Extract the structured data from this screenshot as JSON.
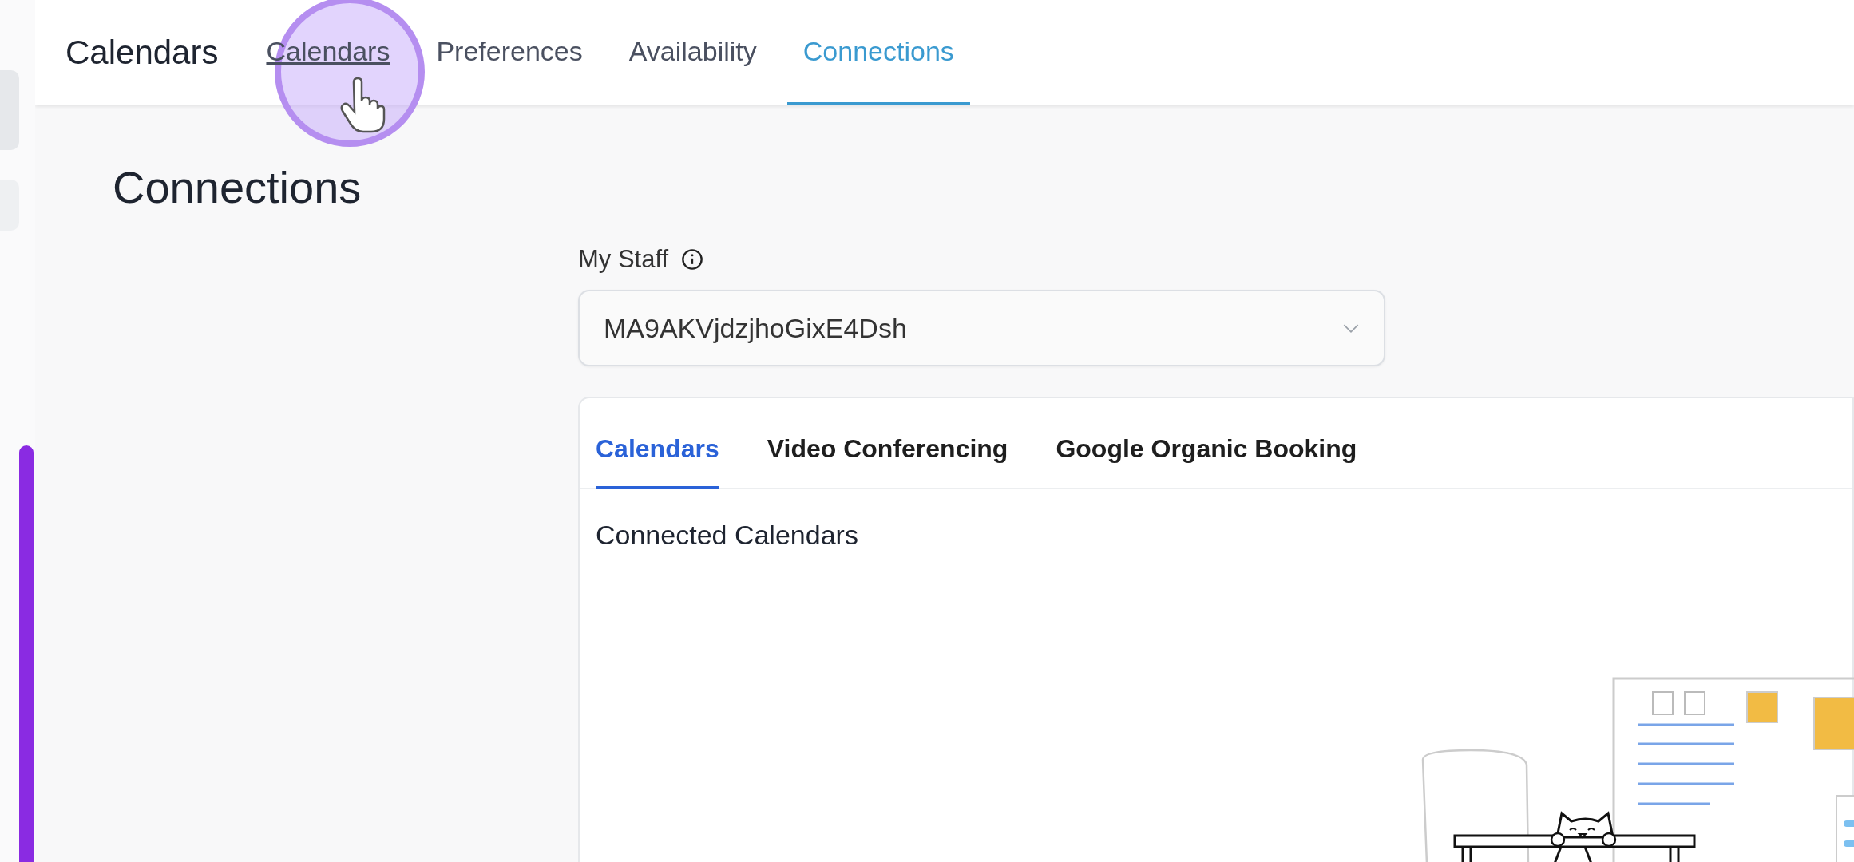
{
  "header": {
    "title": "Calendars",
    "tabs": [
      {
        "label": "Calendars",
        "selected": false,
        "hovered": true
      },
      {
        "label": "Preferences",
        "selected": false,
        "hovered": false
      },
      {
        "label": "Availability",
        "selected": false,
        "hovered": false
      },
      {
        "label": "Connections",
        "selected": true,
        "hovered": false
      }
    ]
  },
  "page_title": "Connections",
  "staff": {
    "label": "My Staff",
    "value": "MA9AKVjdzjhoGixE4Dsh"
  },
  "card": {
    "tabs": [
      {
        "label": "Calendars",
        "selected": true
      },
      {
        "label": "Video Conferencing",
        "selected": false
      },
      {
        "label": "Google Organic Booking",
        "selected": false
      }
    ],
    "section_title": "Connected Calendars"
  }
}
